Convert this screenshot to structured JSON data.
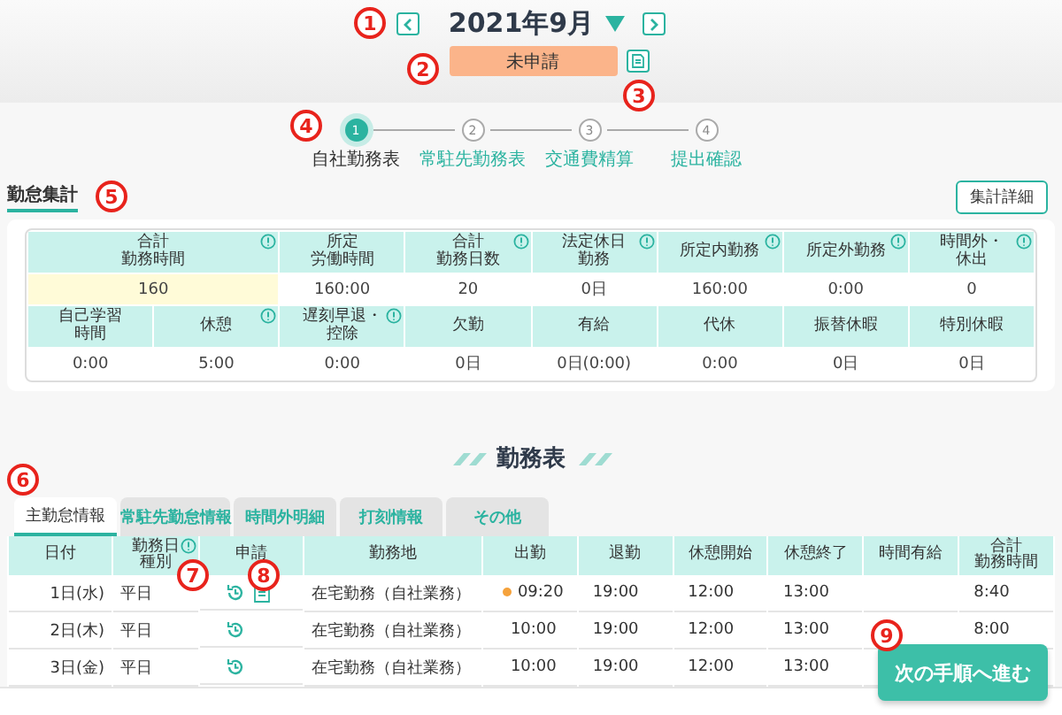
{
  "month": {
    "label": "2021年9月"
  },
  "status": {
    "label": "未申請"
  },
  "steps": [
    {
      "number": "1",
      "label": "自社勤務表",
      "selected": true
    },
    {
      "number": "2",
      "label": "常駐先勤務表",
      "selected": false
    },
    {
      "number": "3",
      "label": "交通費精算",
      "selected": false
    },
    {
      "number": "4",
      "label": "提出確認",
      "selected": false
    }
  ],
  "summary": {
    "title": "勤怠集計",
    "detail_button": "集計詳細",
    "row1": [
      {
        "label": [
          "合計",
          "勤務時間"
        ],
        "info": true,
        "value": "160",
        "highlight": true
      },
      {
        "label": [
          "所定",
          "労働時間"
        ],
        "info": false,
        "value": "160:00",
        "highlight": false
      },
      {
        "label": [
          "合計",
          "勤務日数"
        ],
        "info": true,
        "value": "20",
        "highlight": false
      },
      {
        "label": [
          "法定休日",
          "勤務"
        ],
        "info": true,
        "value": "0日",
        "highlight": false
      },
      {
        "label": [
          "所定内勤務"
        ],
        "info": true,
        "value": "160:00",
        "highlight": false
      },
      {
        "label": [
          "所定外勤務"
        ],
        "info": true,
        "value": "0:00",
        "highlight": false
      },
      {
        "label": [
          "時間外・",
          "休出"
        ],
        "info": true,
        "value": "0",
        "highlight": false
      }
    ],
    "row2": [
      {
        "label": [
          "自己学習",
          "時間"
        ],
        "info": false,
        "value": "0:00",
        "highlight": false
      },
      {
        "label": [
          "休憩"
        ],
        "info": true,
        "value": "5:00",
        "highlight": false
      },
      {
        "label": [
          "遅刻早退・",
          "控除"
        ],
        "info": true,
        "value": "0:00",
        "highlight": false
      },
      {
        "label": [
          "欠勤"
        ],
        "info": false,
        "value": "0日",
        "highlight": false
      },
      {
        "label": [
          "有給"
        ],
        "info": false,
        "value": "0日(0:00)",
        "highlight": false
      },
      {
        "label": [
          "代休"
        ],
        "info": false,
        "value": "0:00",
        "highlight": false
      },
      {
        "label": [
          "振替休暇"
        ],
        "info": false,
        "value": "0日",
        "highlight": false
      },
      {
        "label": [
          "特別休暇"
        ],
        "info": false,
        "value": "0日",
        "highlight": false
      }
    ]
  },
  "sheet_title": "勤務表",
  "tabs": [
    {
      "label": "主勤怠情報",
      "selected": true
    },
    {
      "label": "常駐先勤怠情報",
      "selected": false
    },
    {
      "label": "時間外明細",
      "selected": false
    },
    {
      "label": "打刻情報",
      "selected": false
    },
    {
      "label": "その他",
      "selected": false
    }
  ],
  "table": {
    "columns": [
      {
        "label": [
          "日付"
        ],
        "info": false
      },
      {
        "label": [
          "勤務日",
          "種別"
        ],
        "info": true
      },
      {
        "label": [
          "申請"
        ],
        "info": false
      },
      {
        "label": [
          "勤務地"
        ],
        "info": false
      },
      {
        "label": [
          "出勤"
        ],
        "info": false
      },
      {
        "label": [
          "退勤"
        ],
        "info": false
      },
      {
        "label": [
          "休憩開始"
        ],
        "info": false
      },
      {
        "label": [
          "休憩終了"
        ],
        "info": false
      },
      {
        "label": [
          "時間有給"
        ],
        "info": false
      },
      {
        "label": [
          "合計",
          "勤務時間"
        ],
        "info": false
      }
    ],
    "rows": [
      {
        "date": "1日(水)",
        "type": "平日",
        "document": true,
        "place": "在宅勤務（自社業務）",
        "late": true,
        "start": "09:20",
        "end": "19:00",
        "break_start": "12:00",
        "break_end": "13:00",
        "total": "8:40"
      },
      {
        "date": "2日(木)",
        "type": "平日",
        "document": false,
        "place": "在宅勤務（自社業務）",
        "late": false,
        "start": "10:00",
        "end": "19:00",
        "break_start": "12:00",
        "break_end": "13:00",
        "total": "8:00"
      },
      {
        "date": "3日(金)",
        "type": "平日",
        "document": false,
        "place": "在宅勤務（自社業務）",
        "late": false,
        "start": "10:00",
        "end": "19:00",
        "break_start": "12:00",
        "break_end": "13:00"
      }
    ]
  },
  "next_button": "次の手順へ進む",
  "callouts": [
    "1",
    "2",
    "3",
    "4",
    "5",
    "6",
    "7",
    "8",
    "9"
  ]
}
